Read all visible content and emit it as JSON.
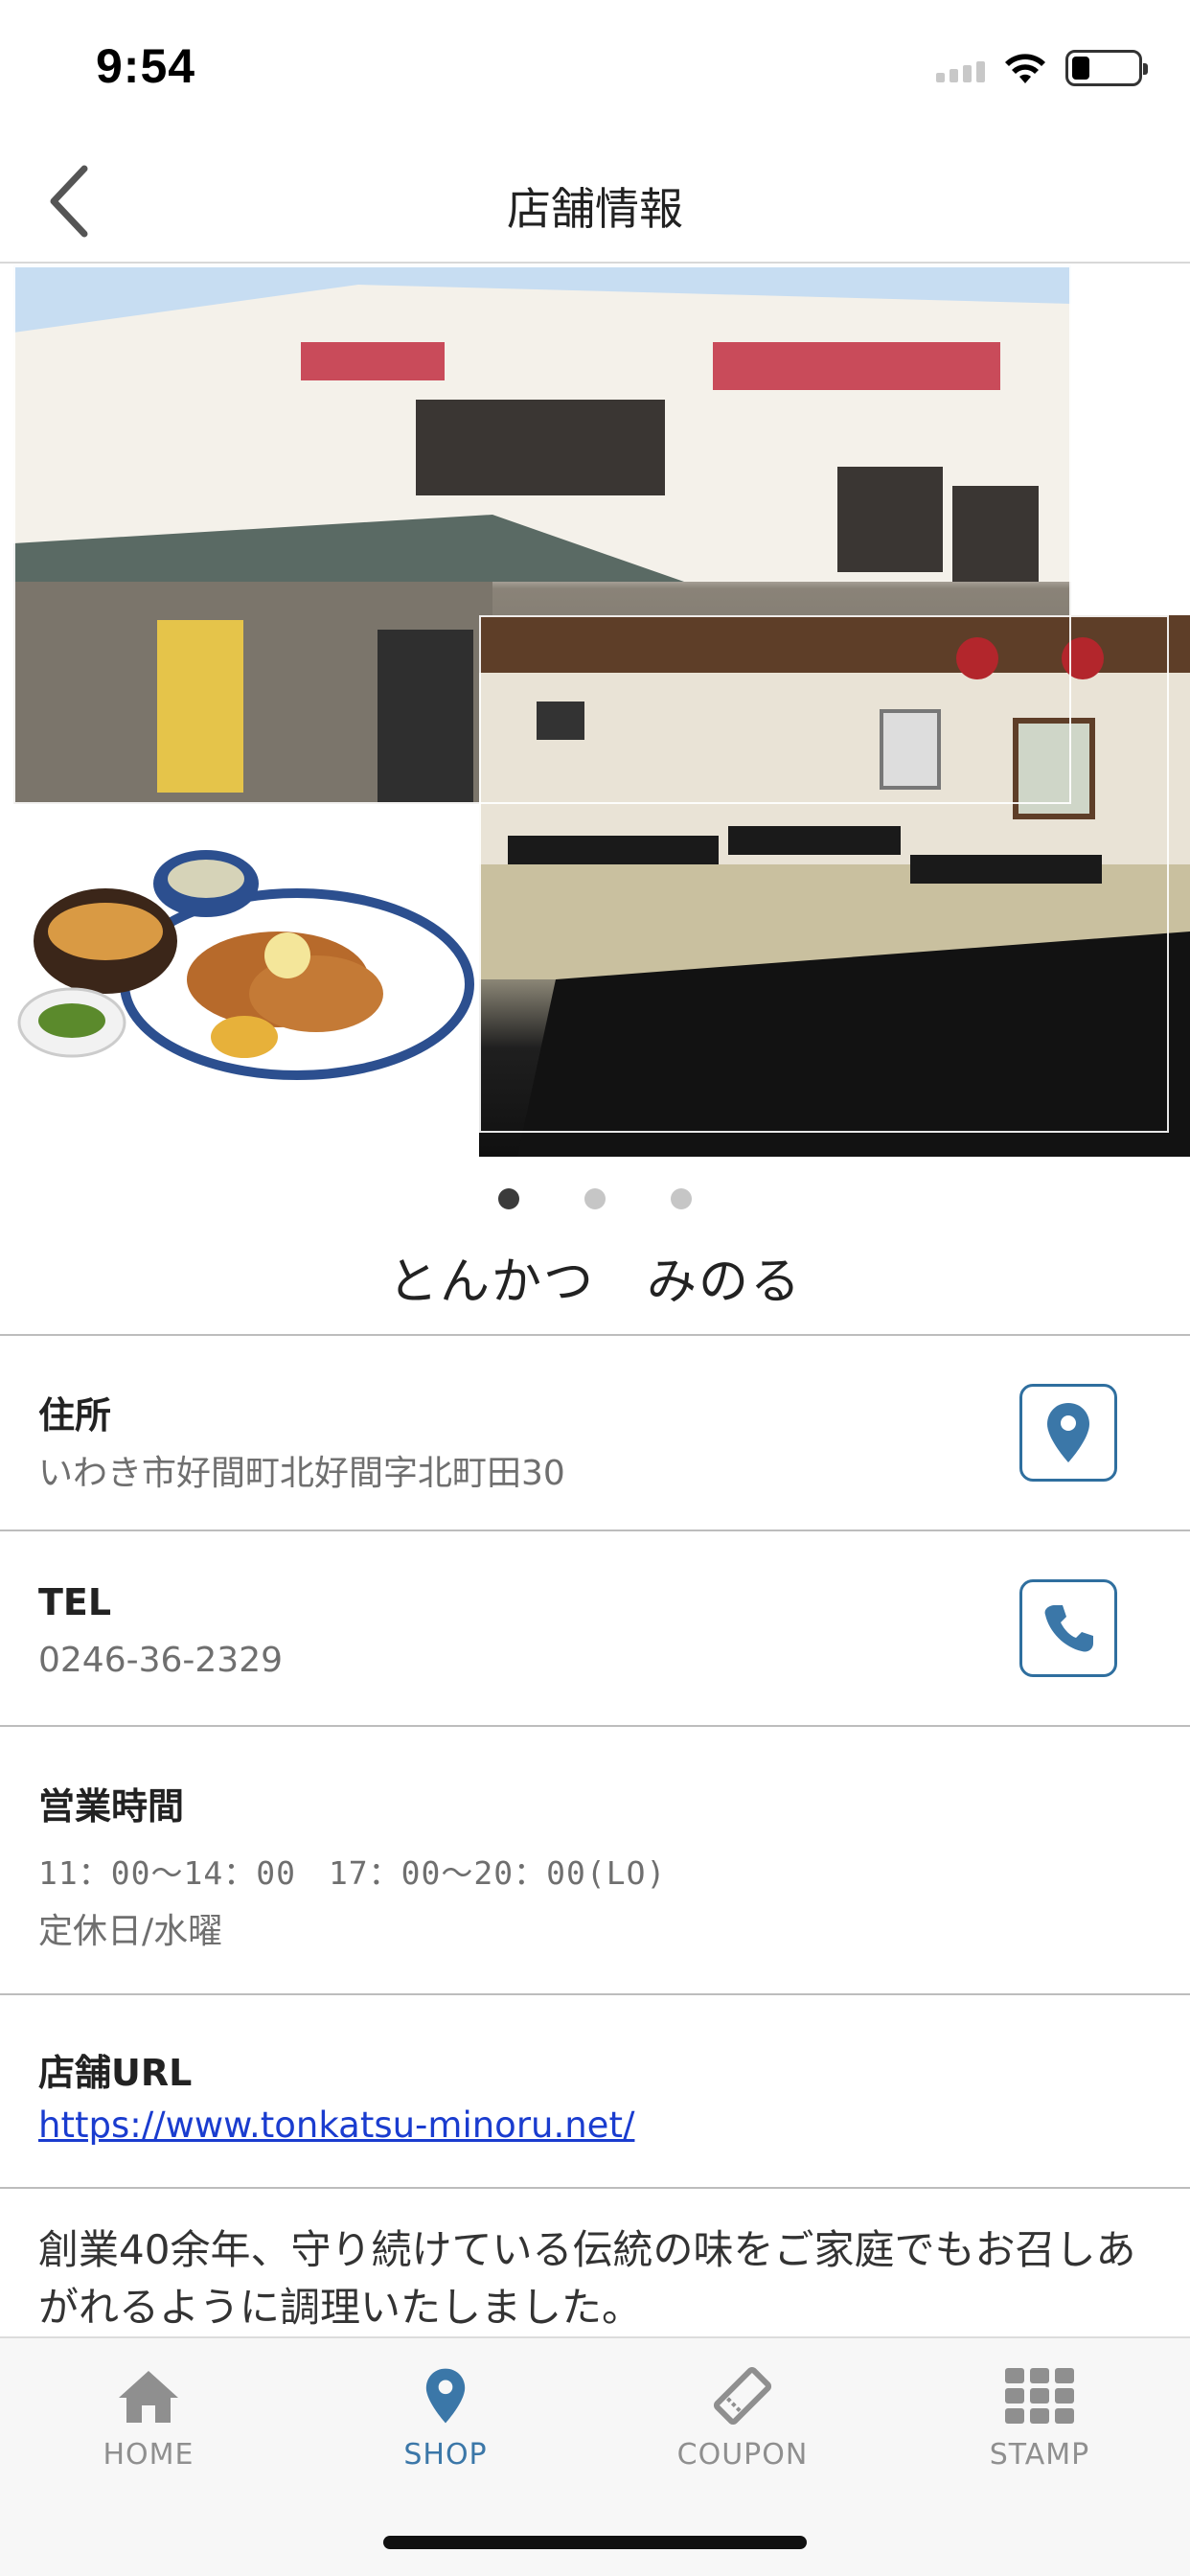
{
  "status_bar": {
    "time": "9:54",
    "icons": [
      "signal-icon",
      "wifi-icon",
      "battery-icon"
    ]
  },
  "nav": {
    "title": "店舗情報",
    "back_icon": "chevron-left-icon"
  },
  "carousel": {
    "images": [
      "restaurant-exterior-photo",
      "restaurant-interior-photo",
      "tonkatsu-set-meal-photo"
    ],
    "page_count": 3,
    "active_page": 1
  },
  "shop": {
    "name": "とんかつ　みのる"
  },
  "address": {
    "label": "住所",
    "value": "いわき市好間町北好間字北町田30",
    "action_icon": "map-pin-icon"
  },
  "tel": {
    "label": "TEL",
    "value": "0246-36-2329",
    "action_icon": "phone-icon"
  },
  "hours": {
    "label": "営業時間",
    "value": "11：00～14：00　17：00～20：00(LO)",
    "holiday": "定休日/水曜"
  },
  "url": {
    "label": "店舗URL",
    "value": "https://www.tonkatsu-minoru.net/"
  },
  "description": "創業40余年、守り続けている伝統の味をご家庭でもお召しあがれるように調理いたしました。",
  "tabs": [
    {
      "label": "HOME",
      "icon": "home-icon",
      "active": false
    },
    {
      "label": "SHOP",
      "icon": "map-pin-icon",
      "active": true
    },
    {
      "label": "COUPON",
      "icon": "ticket-icon",
      "active": false
    },
    {
      "label": "STAMP",
      "icon": "grid-icon",
      "active": false
    }
  ],
  "colors": {
    "accent": "#3b77a8",
    "tab_inactive": "#8f8f8f",
    "link": "#1a3ccf",
    "divider": "#bdbdbd"
  }
}
